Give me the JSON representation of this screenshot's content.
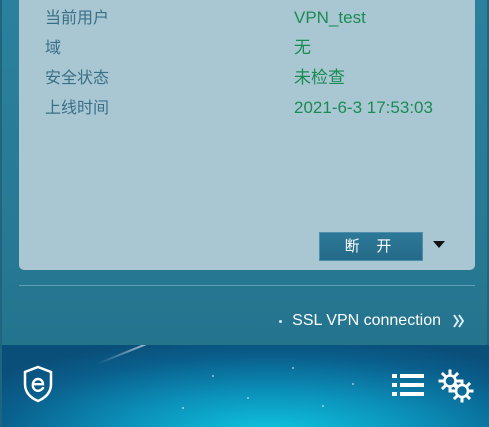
{
  "info": {
    "rows": [
      {
        "label": "当前用户",
        "value": "VPN_test"
      },
      {
        "label": "域",
        "value": "无"
      },
      {
        "label": "安全状态",
        "value": "未检查"
      },
      {
        "label": "上线时间",
        "value": "2021-6-3 17:53:03"
      }
    ]
  },
  "actions": {
    "disconnect_label": "断 开"
  },
  "ssl": {
    "link_label": "SSL VPN connection"
  },
  "icons": {
    "dropdown": "triangle-down-icon",
    "ssl_chevron": "double-chevron-right-icon",
    "brand": "shield-e-logo-icon",
    "list": "list-icon",
    "settings": "gears-icon"
  },
  "colors": {
    "panel_bg": "#a9c7d2",
    "label_text": "#3a6f88",
    "value_text": "#1a8b54",
    "window_bg": "#2b819d",
    "button_bg": "#2d7898"
  }
}
